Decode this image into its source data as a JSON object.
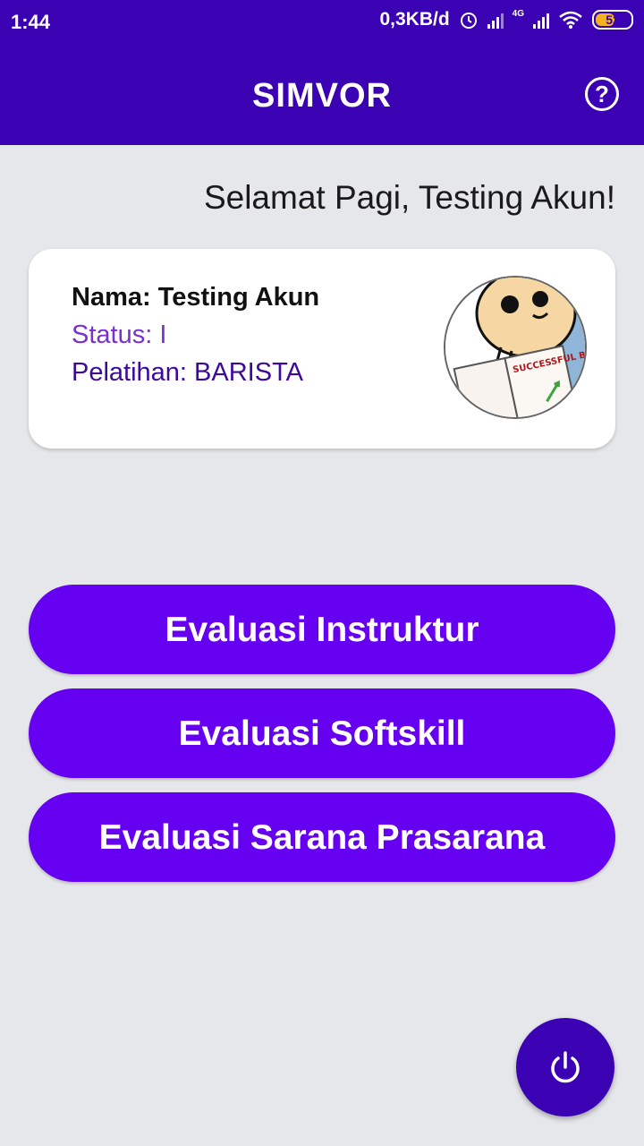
{
  "status_bar": {
    "time": "1:44",
    "speed": "0,3KB/d",
    "network_type": "4G",
    "battery": "52"
  },
  "app_bar": {
    "title": "SIMVOR",
    "help_icon": "help-circle-icon"
  },
  "greeting": "Selamat Pagi, Testing Akun!",
  "profile": {
    "name_line": "Nama: Testing Akun",
    "status_line": "Status: I",
    "training_line": "Pelatihan: BARISTA",
    "avatar_book_text": "SUCCESSFUL BUSINESS TIPS"
  },
  "actions": {
    "instructor": "Evaluasi Instruktur",
    "softskill": "Evaluasi Softskill",
    "facilities": "Evaluasi Sarana Prasarana"
  },
  "fab": {
    "icon": "power-icon"
  },
  "colors": {
    "primary": "#3b02b3",
    "button": "#6600f0",
    "background": "#e6e7ea",
    "status_text": "#7a2fd1",
    "training_text": "#3c0a9a"
  }
}
